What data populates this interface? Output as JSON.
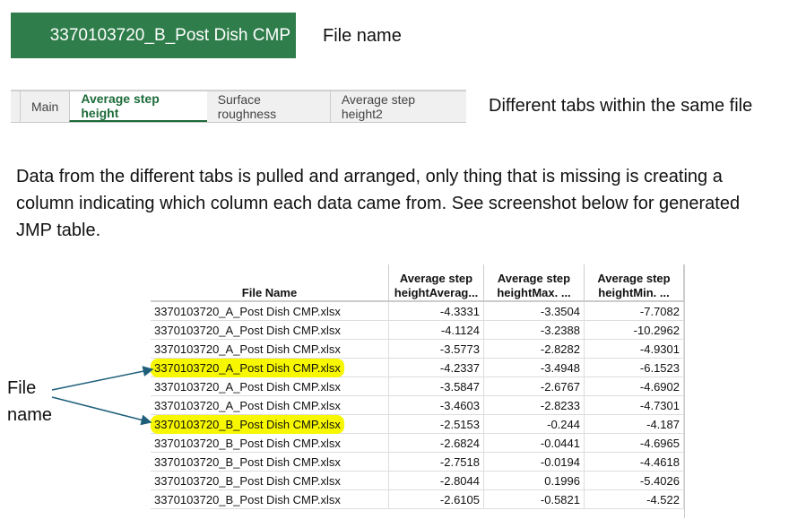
{
  "banner": {
    "file_name": "3370103720_B_Post Dish CMP"
  },
  "labels": {
    "file_name": "File name",
    "tabs_note": "Different tabs within the same file",
    "arrow_label": "File name"
  },
  "tabs": [
    {
      "label": "Main"
    },
    {
      "label": "Average step height"
    },
    {
      "label": "Surface roughness"
    },
    {
      "label": "Average step height2"
    }
  ],
  "paragraph": "Data from the different tabs is pulled and arranged, only thing that is missing is creating a column indicating which column each data came from. See screenshot below for generated JMP table.",
  "table": {
    "headers": [
      "File Name",
      "Average step heightAverag...",
      "Average step heightMax. ...",
      "Average step heightMin. ..."
    ],
    "rows": [
      [
        "3370103720_A_Post Dish CMP.xlsx",
        "-4.3331",
        "-3.3504",
        "-7.7082"
      ],
      [
        "3370103720_A_Post Dish CMP.xlsx",
        "-4.1124",
        "-3.2388",
        "-10.2962"
      ],
      [
        "3370103720_A_Post Dish CMP.xlsx",
        "-3.5773",
        "-2.8282",
        "-4.9301"
      ],
      [
        "3370103720_A_Post Dish CMP.xlsx",
        "-4.2337",
        "-3.4948",
        "-6.1523"
      ],
      [
        "3370103720_A_Post Dish CMP.xlsx",
        "-3.5847",
        "-2.6767",
        "-4.6902"
      ],
      [
        "3370103720_A_Post Dish CMP.xlsx",
        "-3.4603",
        "-2.8233",
        "-4.7301"
      ],
      [
        "3370103720_B_Post Dish CMP.xlsx",
        "-2.5153",
        "-0.244",
        "-4.187"
      ],
      [
        "3370103720_B_Post Dish CMP.xlsx",
        "-2.6824",
        "-0.0441",
        "-4.6965"
      ],
      [
        "3370103720_B_Post Dish CMP.xlsx",
        "-2.7518",
        "-0.0194",
        "-4.4618"
      ],
      [
        "3370103720_B_Post Dish CMP.xlsx",
        "-2.8044",
        "0.1996",
        "-5.4026"
      ],
      [
        "3370103720_B_Post Dish CMP.xlsx",
        "-2.6105",
        "-0.5821",
        "-4.522"
      ]
    ],
    "highlighted_rows": [
      3,
      6
    ]
  }
}
